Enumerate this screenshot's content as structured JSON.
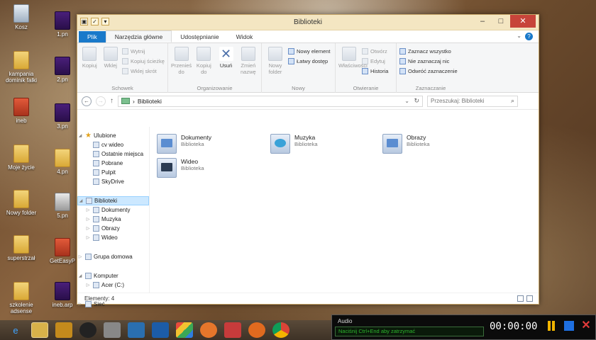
{
  "desktop": {
    "icons": [
      {
        "label": "Kosz",
        "kind": "bin"
      },
      {
        "label": "kampania dominik falki",
        "kind": "folder"
      },
      {
        "label": "ineb",
        "kind": "pdf"
      },
      {
        "label": "Moje życie",
        "kind": "folder"
      },
      {
        "label": "Nowy folder",
        "kind": "folder"
      },
      {
        "label": "superstrzał",
        "kind": "folder"
      },
      {
        "label": "szkolenie adsense",
        "kind": "folder"
      },
      {
        "label": "1.pn",
        "kind": "media"
      },
      {
        "label": "2.pn",
        "kind": "media"
      },
      {
        "label": "3.pn",
        "kind": "media"
      },
      {
        "label": "4.pn",
        "kind": "folder"
      },
      {
        "label": "5.pn",
        "kind": "warn"
      },
      {
        "label": "GetEasyP",
        "kind": "pdf"
      },
      {
        "label": "ineb.arp",
        "kind": "media"
      }
    ]
  },
  "window": {
    "title": "Biblioteki",
    "qat_items": [
      "▣",
      "✓",
      "▾"
    ],
    "controls": {
      "minimize": "–",
      "maximize": "□",
      "close": "✕"
    }
  },
  "ribbon": {
    "tabs": [
      "Plik",
      "Narzędzia główne",
      "Udostępnianie",
      "Widok"
    ],
    "groups": {
      "schowek": {
        "label": "Schowek",
        "copy": "Kopiuj",
        "paste": "Wklej",
        "cut": "Wytnij",
        "copy_path": "Kopiuj ścieżkę",
        "paste_shortcut": "Wklej skrót"
      },
      "organizowanie": {
        "label": "Organizowanie",
        "move_to": "Przenieś do",
        "copy_to": "Kopiuj do",
        "delete": "Usuń",
        "rename": "Zmień nazwę"
      },
      "nowy": {
        "label": "Nowy",
        "new_folder": "Nowy folder",
        "new_item": "Nowy element",
        "easy_access": "Łatwy dostęp"
      },
      "otwieranie": {
        "label": "Otwieranie",
        "properties": "Właściwości",
        "open": "Otwórz",
        "edit": "Edytuj",
        "history": "Historia"
      },
      "zaznaczanie": {
        "label": "Zaznaczanie",
        "select_all": "Zaznacz wszystko",
        "select_none": "Nie zaznaczaj nic",
        "invert": "Odwróć zaznaczenie"
      }
    }
  },
  "address": {
    "path": "Biblioteki",
    "search_placeholder": "Przeszukaj: Biblioteki"
  },
  "nav_pane": {
    "favorites": {
      "label": "Ulubione",
      "items": [
        "cv wideo",
        "Ostatnie miejsca",
        "Pobrane",
        "Pulpit",
        "SkyDrive"
      ]
    },
    "libraries": {
      "label": "Biblioteki",
      "items": [
        "Dokumenty",
        "Muzyka",
        "Obrazy",
        "Wideo"
      ]
    },
    "homegroup": "Grupa domowa",
    "computer": {
      "label": "Komputer",
      "items": [
        "Acer (C:)"
      ]
    },
    "network": "Sieć"
  },
  "content": {
    "libraries": [
      {
        "name": "Dokumenty",
        "type": "Biblioteka"
      },
      {
        "name": "Muzyka",
        "type": "Biblioteka"
      },
      {
        "name": "Obrazy",
        "type": "Biblioteka"
      },
      {
        "name": "Wideo",
        "type": "Biblioteka"
      }
    ]
  },
  "status": {
    "items_count": "Elementy: 4"
  },
  "recorder": {
    "label": "Audio",
    "hint": "Naciśnij Ctrl+End aby zatrzymać",
    "time": "00:00:00"
  }
}
